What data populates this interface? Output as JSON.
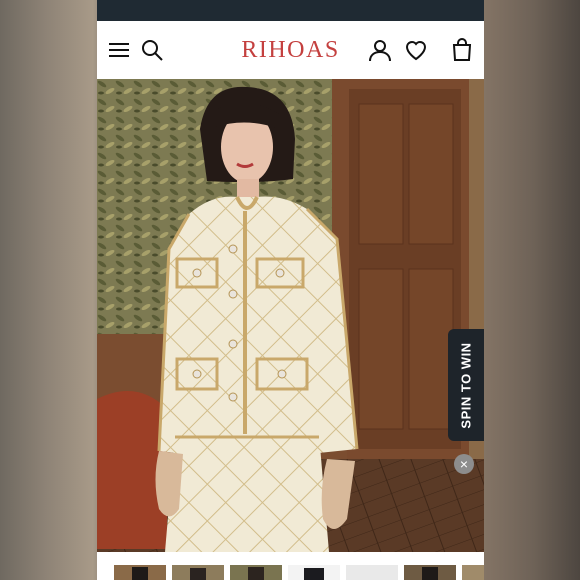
{
  "header": {
    "brand": "RIHOAS",
    "icons": [
      "menu-icon",
      "search-icon",
      "account-icon",
      "heart-icon",
      "bag-icon"
    ]
  },
  "promo": {
    "spin_label": "SPIN TO WIN",
    "close_symbol": "×"
  },
  "colors": {
    "brand": "#c4403f",
    "announcement_bar": "#1f2a33",
    "spin_badge": "#1e242a"
  },
  "gallery": {
    "thumbnail_count": 7
  }
}
